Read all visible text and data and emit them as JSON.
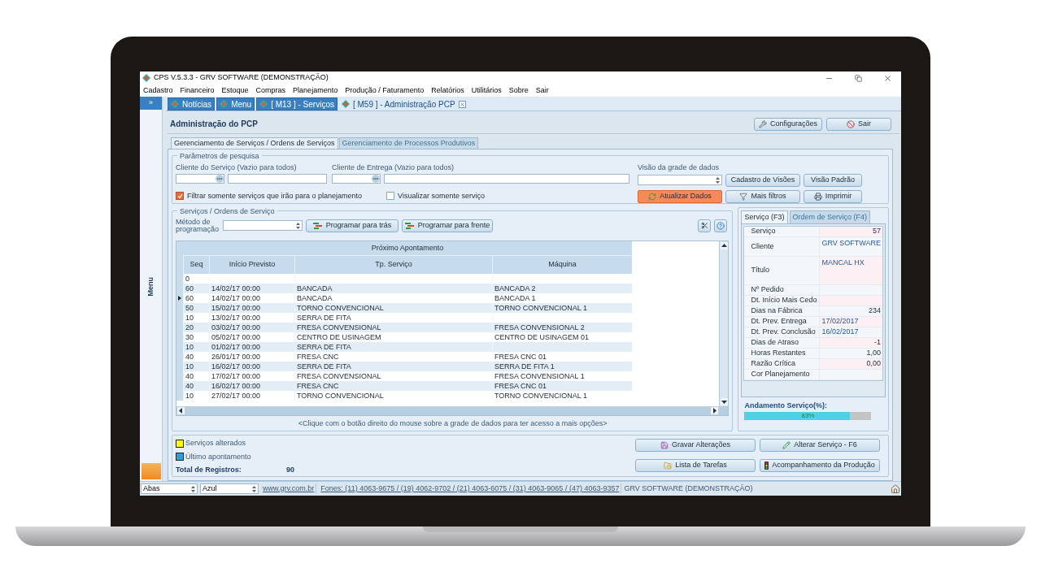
{
  "window": {
    "title": "CPS V.5.3.3 - GRV SOFTWARE (DEMONSTRAÇÃO)"
  },
  "menu": [
    "Cadastro",
    "Financeiro",
    "Estoque",
    "Compras",
    "Planejamento",
    "Produção / Faturamento",
    "Relatórios",
    "Utilitários",
    "Sobre",
    "Sair"
  ],
  "sidebar": {
    "toggle": "»",
    "label": "Menu"
  },
  "doc_tabs": [
    {
      "label": "Notícias",
      "selected": false
    },
    {
      "label": "Menu",
      "selected": false
    },
    {
      "label": "[ M13 ] - Serviços",
      "selected": false
    },
    {
      "label": "[ M59 ] - Administração PCP",
      "selected": true
    }
  ],
  "page_title": "Administração do PCP",
  "header_buttons": {
    "settings": "Configurações",
    "exit": "Sair"
  },
  "sub_tabs": [
    {
      "label": "Gerenciamento de Serviços / Ordens de Serviços",
      "selected": true
    },
    {
      "label": "Gerenciamento de Processos Produtivos",
      "selected": false
    }
  ],
  "search": {
    "legend": "Parâmetros de pesquisa",
    "client_label": "Cliente do Serviço (Vazio para todos)",
    "delivery_label": "Cliente de Entrega (Vazio para todos)",
    "view_label": "Visão da grade de dados",
    "filter_checkbox": {
      "label": "Filtrar somente serviços que irão para o planejamento",
      "checked": true
    },
    "service_only_checkbox": {
      "label": "Visualizar somente serviço",
      "checked": false
    },
    "views_button": "Cadastro de Visões",
    "default_view_button": "Visão Padrão",
    "refresh_button": "Atualizar Dados",
    "filters_button": "Mais filtros",
    "print_button": "Imprimir"
  },
  "services": {
    "legend": "Serviços / Ordens de Serviço",
    "method_label": "Método de programação",
    "backward_button": "Programar para trás",
    "forward_button": "Programar para frente",
    "group_header": "Próximo Apontamento",
    "columns": [
      "Seq",
      "Início Previsto",
      "Tp. Serviço",
      "Máquina"
    ],
    "rows": [
      {
        "seq": "0",
        "selected": false
      },
      {
        "seq": "60",
        "start": "14/02/17 00:00",
        "service": "BANCADA",
        "machine": "BANCADA 2",
        "selected": false
      },
      {
        "seq": "60",
        "start": "14/02/17 00:00",
        "service": "BANCADA",
        "machine": "BANCADA 1",
        "selected": true
      },
      {
        "seq": "50",
        "start": "15/02/17 00:00",
        "service": "TORNO CONVENCIONAL",
        "machine": "TORNO CONVENCIONAL 1",
        "selected": false
      },
      {
        "seq": "10",
        "start": "13/02/17 00:00",
        "service": "SERRA DE FITA",
        "selected": false
      },
      {
        "seq": "20",
        "start": "03/02/17 00:00",
        "service": "FRESA CONVENSIONAL",
        "machine": "FRESA CONVENSIONAL 2",
        "selected": false
      },
      {
        "seq": "30",
        "start": "05/02/17 00:00",
        "service": "CENTRO DE USINAGEM",
        "machine": "CENTRO DE USINAGEM 01",
        "selected": false
      },
      {
        "seq": "10",
        "start": "01/02/17 00:00",
        "service": "SERRA DE FITA",
        "selected": false
      },
      {
        "seq": "40",
        "start": "26/01/17 00:00",
        "service": "FRESA CNC",
        "machine": "FRESA CNC 01",
        "selected": false
      },
      {
        "seq": "10",
        "start": "16/02/17 00:00",
        "service": "SERRA DE FITA",
        "machine": "SERRA DE FITA 1",
        "selected": false
      },
      {
        "seq": "40",
        "start": "17/02/17 00:00",
        "service": "FRESA CONVENSIONAL",
        "machine": "FRESA CONVENSIONAL 1",
        "selected": false
      },
      {
        "seq": "40",
        "start": "16/02/17 00:00",
        "service": "FRESA CNC",
        "machine": "FRESA CNC 01",
        "selected": false
      },
      {
        "seq": "10",
        "start": "27/02/17 00:00",
        "service": "TORNO CONVENCIONAL",
        "machine": "TORNO CONVENCIONAL 1",
        "selected": false
      }
    ],
    "hint": "<Clique com o botão direito do mouse sobre a grade de dados para ter acesso a mais opções>"
  },
  "detail_tabs": [
    {
      "label": "Serviço (F3)",
      "selected": true
    },
    {
      "label": "Ordem de Serviço (F4)",
      "selected": false
    }
  ],
  "properties": [
    {
      "label": "Serviço",
      "value": "57",
      "kind": "number"
    },
    {
      "label": "Cliente",
      "value": "GRV SOFTWARE",
      "kind": "text"
    },
    {
      "label": "Título",
      "value": "MANCAL HX",
      "kind": "memo"
    },
    {
      "label": "Nº Pedido",
      "kind": "number"
    },
    {
      "label": "Dt. Início Mais Cedo",
      "kind": "number"
    },
    {
      "label": "Dias na Fábrica",
      "value": "234",
      "kind": "number"
    },
    {
      "label": "Dt. Prev. Entrega",
      "value": "17/02/2017",
      "kind": "date"
    },
    {
      "label": "Dt. Prev. Conclusão",
      "value": "16/02/2017",
      "kind": "date"
    },
    {
      "label": "Dias de Atraso",
      "value": "-1",
      "kind": "number"
    },
    {
      "label": "Horas Restantes",
      "value": "1,00",
      "kind": "number"
    },
    {
      "label": "Razão Crítica",
      "value": "0,00",
      "kind": "number"
    },
    {
      "label": "Cor Planejamento",
      "kind": "number"
    }
  ],
  "progress": {
    "label": "Andamento Serviço(%):",
    "level": 0.83,
    "reading": "83%"
  },
  "legend": [
    {
      "label": "Serviços alterados",
      "color": "#ffff00"
    },
    {
      "label": "Último apontamento",
      "color": "#2e9fd8"
    }
  ],
  "total": {
    "label": "Total de Registros:",
    "value": "90"
  },
  "actions": {
    "save": "Gravar Alterações",
    "edit": "Alterar Serviço - F6",
    "tasks": "Lista de Tarefas",
    "tracking": "Acompanhamento da Produção"
  },
  "status_bar": {
    "layout_combo": "Abas",
    "theme_combo": "Azul",
    "site_link": "www.grv.com.br",
    "phones_link": "Fones: (11) 4063-9675 / (19) 4062-9702 / (21) 4063-6075 / (31) 4063-9065 / (47) 4063-9357",
    "company": "GRV SOFTWARE (DEMONSTRAÇÃO)"
  }
}
